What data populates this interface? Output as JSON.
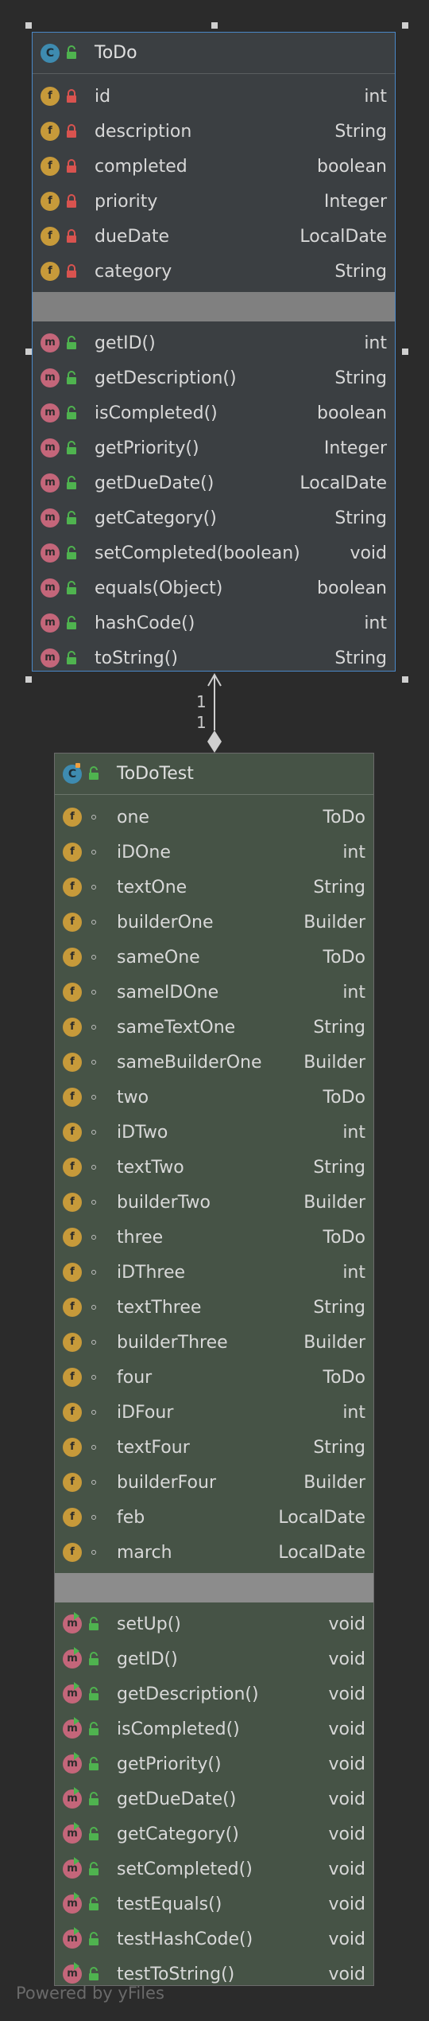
{
  "todo_class": {
    "badge": "C",
    "name": "ToDo",
    "fields": [
      {
        "name": "id",
        "type": "int"
      },
      {
        "name": "description",
        "type": "String"
      },
      {
        "name": "completed",
        "type": "boolean"
      },
      {
        "name": "priority",
        "type": "Integer"
      },
      {
        "name": "dueDate",
        "type": "LocalDate"
      },
      {
        "name": "category",
        "type": "String"
      }
    ],
    "methods": [
      {
        "name": "getID()",
        "type": "int"
      },
      {
        "name": "getDescription()",
        "type": "String"
      },
      {
        "name": "isCompleted()",
        "type": "boolean"
      },
      {
        "name": "getPriority()",
        "type": "Integer"
      },
      {
        "name": "getDueDate()",
        "type": "LocalDate"
      },
      {
        "name": "getCategory()",
        "type": "String"
      },
      {
        "name": "setCompleted(boolean)",
        "type": "void"
      },
      {
        "name": "equals(Object)",
        "type": "boolean"
      },
      {
        "name": "hashCode()",
        "type": "int"
      },
      {
        "name": "toString()",
        "type": "String"
      }
    ]
  },
  "test_class": {
    "badge": "C",
    "name": "ToDoTest",
    "fields": [
      {
        "name": "one",
        "type": "ToDo"
      },
      {
        "name": "iDOne",
        "type": "int"
      },
      {
        "name": "textOne",
        "type": "String"
      },
      {
        "name": "builderOne",
        "type": "Builder"
      },
      {
        "name": "sameOne",
        "type": "ToDo"
      },
      {
        "name": "sameIDOne",
        "type": "int"
      },
      {
        "name": "sameTextOne",
        "type": "String"
      },
      {
        "name": "sameBuilderOne",
        "type": "Builder"
      },
      {
        "name": "two",
        "type": "ToDo"
      },
      {
        "name": "iDTwo",
        "type": "int"
      },
      {
        "name": "textTwo",
        "type": "String"
      },
      {
        "name": "builderTwo",
        "type": "Builder"
      },
      {
        "name": "three",
        "type": "ToDo"
      },
      {
        "name": "iDThree",
        "type": "int"
      },
      {
        "name": "textThree",
        "type": "String"
      },
      {
        "name": "builderThree",
        "type": "Builder"
      },
      {
        "name": "four",
        "type": "ToDo"
      },
      {
        "name": "iDFour",
        "type": "int"
      },
      {
        "name": "textFour",
        "type": "String"
      },
      {
        "name": "builderFour",
        "type": "Builder"
      },
      {
        "name": "feb",
        "type": "LocalDate"
      },
      {
        "name": "march",
        "type": "LocalDate"
      }
    ],
    "methods": [
      {
        "name": "setUp()",
        "type": "void"
      },
      {
        "name": "getID()",
        "type": "void"
      },
      {
        "name": "getDescription()",
        "type": "void"
      },
      {
        "name": "isCompleted()",
        "type": "void"
      },
      {
        "name": "getPriority()",
        "type": "void"
      },
      {
        "name": "getDueDate()",
        "type": "void"
      },
      {
        "name": "getCategory()",
        "type": "void"
      },
      {
        "name": "setCompleted()",
        "type": "void"
      },
      {
        "name": "testEquals()",
        "type": "void"
      },
      {
        "name": "testHashCode()",
        "type": "void"
      },
      {
        "name": "testToString()",
        "type": "void"
      }
    ]
  },
  "association": {
    "multiplicity_source": "1",
    "multiplicity_target": "1"
  },
  "badges": {
    "field": "f",
    "method": "m"
  },
  "footer": "Powered by yFiles",
  "colors": {
    "background": "#2b2b2b",
    "selected_border": "#4a88c7",
    "field_badge": "#c79a3a",
    "method_badge": "#c4667a",
    "class_badge": "#3e8bb0",
    "private_lock": "#d9534f",
    "public_lock": "#4fb34f"
  }
}
